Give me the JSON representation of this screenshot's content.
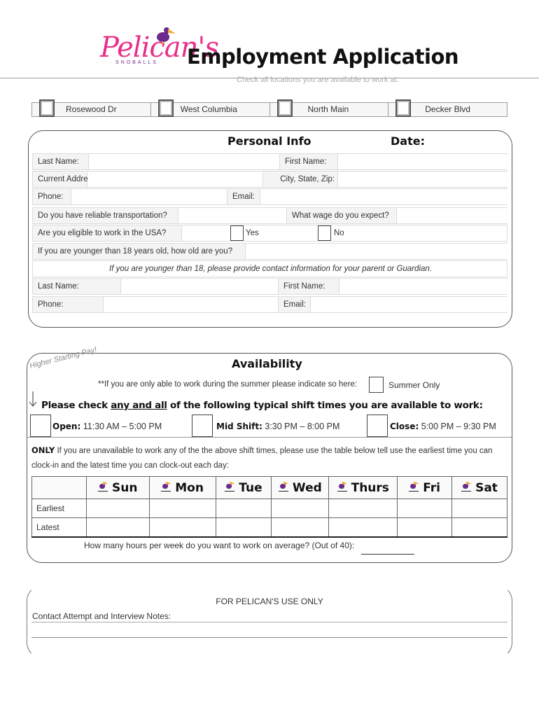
{
  "header": {
    "logo_text": "Pelican's",
    "logo_subtext": "SNOBALLS",
    "title": "Employment Application",
    "subtitle": "Check all locations you are available to work at."
  },
  "locations": [
    {
      "label": "Rosewood Dr",
      "checked": false
    },
    {
      "label": "West Columbia",
      "checked": false
    },
    {
      "label": "North Main",
      "checked": false
    },
    {
      "label": "Decker Blvd",
      "checked": false
    }
  ],
  "personal_info": {
    "title": "Personal Info",
    "date_label": "Date:",
    "last_name_label": "Last Name:",
    "first_name_label": "First Name:",
    "address_label": "Current Address:",
    "city_label": "City, State, Zip:",
    "phone_label": "Phone:",
    "email_label": "Email:",
    "transport_label": "Do you have reliable transportation?",
    "wage_label": "What wage do you expect?",
    "eligible_label": "Are you eligible to work in the USA?",
    "yes_label": "Yes",
    "no_label": "No",
    "age_label": "If you are younger than 18 years old, how old are you?",
    "guardian_note": "If you are younger than 18, please provide contact information for your parent or Guardian.",
    "g_last_name_label": "Last Name:",
    "g_first_name_label": "First Name:",
    "g_phone_label": "Phone:",
    "g_email_label": "Email:"
  },
  "availability": {
    "title": "Availability",
    "higher_pay": "Higher Starting Pay!",
    "summer_note": "**If you are only able to work during the summer please indicate so here:",
    "summer_label": "Summer Only",
    "check_prefix": "Please check ",
    "check_underlined": "any and all",
    "check_suffix": " of the following typical shift times you are available to work:",
    "shifts": [
      {
        "name": "Open:",
        "time": "11:30 AM – 5:00 PM"
      },
      {
        "name": "Mid Shift:",
        "time": "3:30 PM – 8:00 PM"
      },
      {
        "name": "Close:",
        "time": "5:00 PM – 9:30 PM"
      }
    ],
    "only_bold": "ONLY",
    "only_text": " If you are unavailable to work any of the the above shift times, please use the table below tell use the earliest time you can clock-in and the latest time you can clock-out each day:",
    "days": [
      "Sun",
      "Mon",
      "Tue",
      "Wed",
      "Thurs",
      "Fri",
      "Sat"
    ],
    "row_labels": [
      "Earliest",
      "Latest"
    ],
    "hours_question": "How many hours per week do you want to work on average? (Out of 40):"
  },
  "office": {
    "title": "FOR PELICAN'S USE ONLY",
    "notes_label": "Contact Attempt and Interview Notes:"
  },
  "colors": {
    "brand_pink": "#e8308a",
    "brand_purple": "#6b2a8c",
    "brand_orange": "#f2a93b"
  }
}
